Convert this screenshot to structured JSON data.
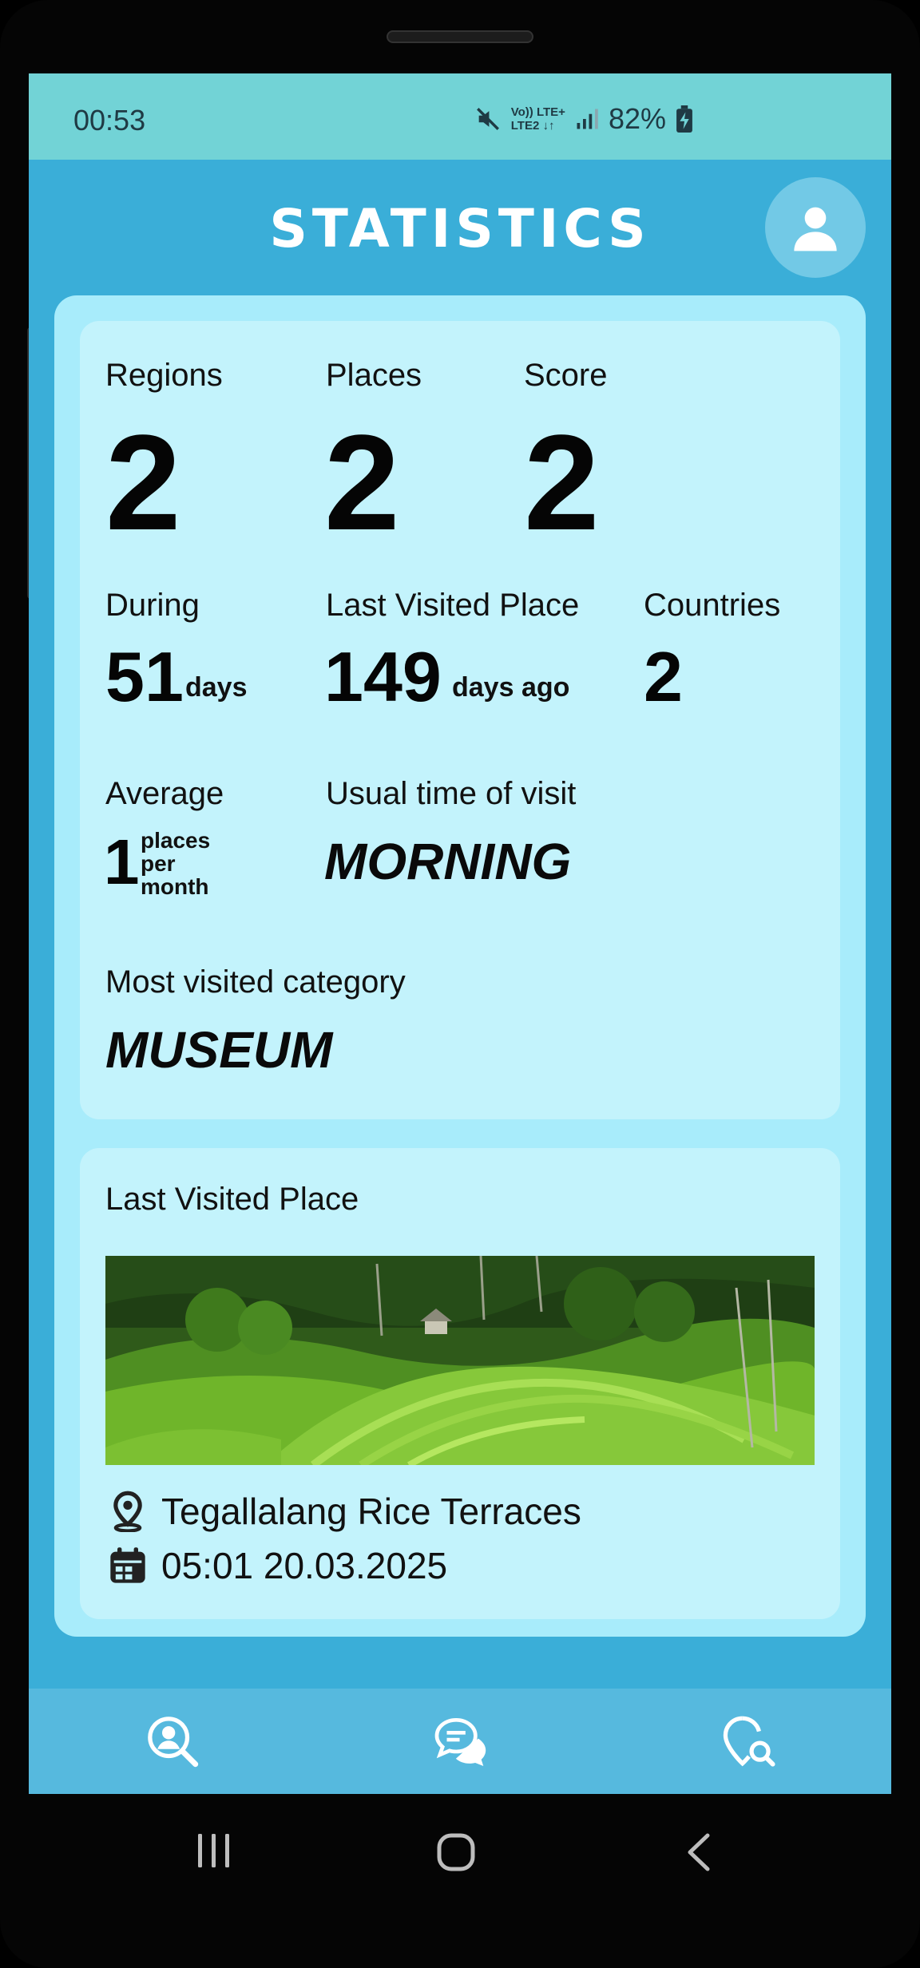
{
  "status_bar": {
    "time": "00:53",
    "network_line1": "Vo)) LTE+",
    "network_line2": "LTE2 ↓↑",
    "battery": "82%"
  },
  "header": {
    "title": "STATISTICS",
    "profile_icon": "user-icon"
  },
  "stats": {
    "regions": {
      "label": "Regions",
      "value": "2"
    },
    "places": {
      "label": "Places",
      "value": "2"
    },
    "score": {
      "label": "Score",
      "value": "2"
    },
    "during": {
      "label": "During",
      "value": "51",
      "unit": "days"
    },
    "last_visited": {
      "label": "Last Visited Place",
      "value": "149",
      "unit": "days ago"
    },
    "countries": {
      "label": "Countries",
      "value": "2"
    },
    "average": {
      "label": "Average",
      "value": "1",
      "unit_line1": "places",
      "unit_line2": "per",
      "unit_line3": "month"
    },
    "usual_time": {
      "label": "Usual time of visit",
      "value": "MORNING"
    },
    "category": {
      "label": "Most visited category",
      "value": "MUSEUM"
    }
  },
  "last_place": {
    "heading": "Last Visited Place",
    "name": "Tegallalang Rice Terraces",
    "datetime": "05:01 20.03.2025",
    "location_icon": "location-pin-icon",
    "calendar_icon": "calendar-icon"
  },
  "bottom_nav": {
    "items": [
      {
        "name": "profile-search-icon"
      },
      {
        "name": "chat-icon"
      },
      {
        "name": "location-search-icon"
      }
    ]
  },
  "colors": {
    "status_bar": "#72d3d6",
    "background": "#3aaed8",
    "outer_card": "#a8ecfb",
    "inner_card": "#c3f3fc",
    "nav_bar": "#56b9de"
  }
}
